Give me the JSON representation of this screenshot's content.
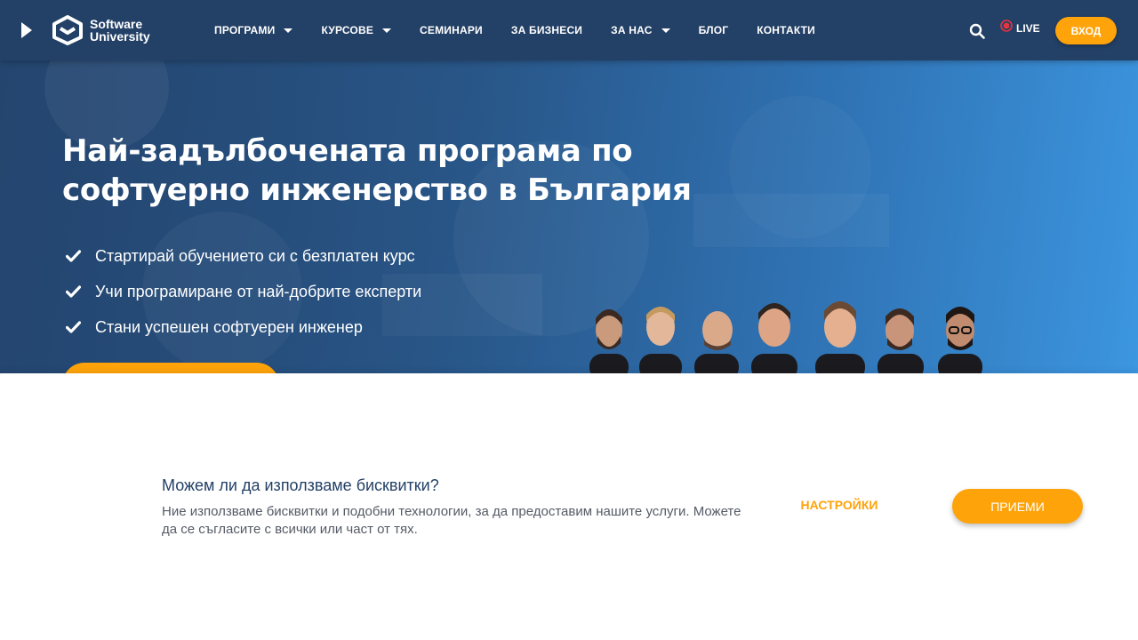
{
  "nav": {
    "logo_line1": "Software",
    "logo_line2": "University",
    "items": [
      {
        "label": "ПРОГРАМИ",
        "dropdown": true
      },
      {
        "label": "КУРСОВЕ",
        "dropdown": true
      },
      {
        "label": "СЕМИНАРИ",
        "dropdown": false
      },
      {
        "label": "ЗА БИЗНЕСИ",
        "dropdown": false
      },
      {
        "label": "ЗА НАС",
        "dropdown": true
      },
      {
        "label": "БЛОГ",
        "dropdown": false
      },
      {
        "label": "КОНТАКТИ",
        "dropdown": false
      }
    ],
    "live_label": "LIVE",
    "login_label": "ВХОД",
    "icons": {
      "play": "play-icon",
      "search": "search-icon",
      "live": "live-dot-icon"
    }
  },
  "hero": {
    "title": "Най-задълбочената програма по софтуерно инженерство в България",
    "bullets": [
      "Стартирай обучението си с безплатен курс",
      "Учи програмиране от най-добрите експерти",
      "Стани успешен софтуерен инженер"
    ]
  },
  "cookie": {
    "title": "Можем ли да използваме бисквитки?",
    "text": "Ние използваме бисквитки и подобни технологии, за да предоставим нашите услуги. Можете да се съгласите с всички или част от тях.",
    "settings_label": "НАСТРОЙКИ",
    "accept_label": "ПРИЕМИ"
  },
  "colors": {
    "nav_bg": "#234066",
    "accent": "#fea30a",
    "hero_light": "#3c96e0",
    "cookie_title": "#234066",
    "live_red": "#e8343f"
  }
}
